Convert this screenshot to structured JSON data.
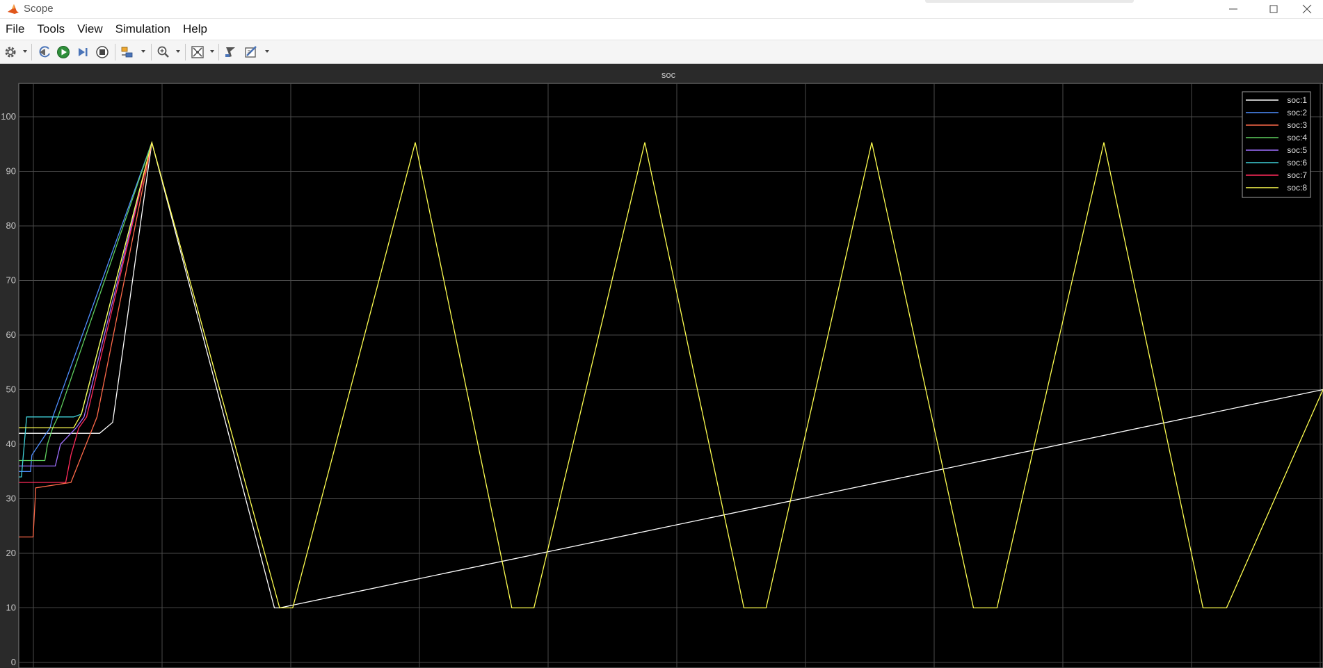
{
  "window": {
    "title": "Scope"
  },
  "menu": [
    "File",
    "Tools",
    "View",
    "Simulation",
    "Help"
  ],
  "toolbar": [
    "settings-icon",
    "step-back-icon",
    "run-icon",
    "step-forward-icon",
    "stop-icon",
    "signal-highlight-icon",
    "zoom-icon",
    "autoscale-icon",
    "cursor-icon",
    "measurements-icon"
  ],
  "colors": {
    "plot_background": "#000000",
    "frame_background": "#2a2a2a",
    "grid": "#4a4a4a",
    "axis_text": "#c8c8c8"
  },
  "chart_data": {
    "type": "line",
    "title": "soc",
    "xlabel": "",
    "ylabel": "",
    "ylim": [
      0,
      100
    ],
    "yticks": [
      0,
      10,
      20,
      30,
      40,
      50,
      60,
      70,
      80,
      90,
      100
    ],
    "grid": true,
    "legend_position": "top-right",
    "series": [
      {
        "name": "soc:1",
        "color": "#ffffff",
        "x": [
          0,
          0.062,
          0.072,
          0.102,
          0.196,
          0.2,
          1.0
        ],
        "y": [
          42,
          42,
          44,
          95.3,
          10,
          10,
          50
        ]
      },
      {
        "name": "soc:2",
        "color": "#4f8fff",
        "x": [
          0,
          0.009,
          0.01,
          0.024,
          0.026,
          0.102
        ],
        "y": [
          35,
          35,
          38,
          43,
          45,
          95.3
        ]
      },
      {
        "name": "soc:3",
        "color": "#ff6a4a",
        "x": [
          0,
          0.011,
          0.013,
          0.04,
          0.06,
          0.102
        ],
        "y": [
          23,
          23,
          32,
          33,
          45,
          95.3
        ]
      },
      {
        "name": "soc:4",
        "color": "#5fcf5f",
        "x": [
          0,
          0.02,
          0.022,
          0.026,
          0.03,
          0.102
        ],
        "y": [
          37,
          37,
          40,
          43,
          45,
          95.3
        ]
      },
      {
        "name": "soc:5",
        "color": "#a070ff",
        "x": [
          0,
          0.028,
          0.032,
          0.044,
          0.05,
          0.102
        ],
        "y": [
          36,
          36,
          40,
          43,
          45,
          95.3
        ]
      },
      {
        "name": "soc:6",
        "color": "#3fd0d8",
        "x": [
          0,
          0.002,
          0.006,
          0.042,
          0.048,
          0.102
        ],
        "y": [
          34,
          34,
          45,
          45,
          45.5,
          95.3
        ]
      },
      {
        "name": "soc:7",
        "color": "#ff2a5a",
        "x": [
          0,
          0.036,
          0.04,
          0.046,
          0.052,
          0.102
        ],
        "y": [
          33,
          33,
          38,
          43,
          45,
          95.3
        ]
      },
      {
        "name": "soc:8",
        "color": "#ffff50",
        "x": [
          0,
          0.042,
          0.048,
          0.102,
          0.2,
          0.21,
          0.304,
          0.378,
          0.395,
          0.48,
          0.556,
          0.573,
          0.654,
          0.732,
          0.75,
          0.832,
          0.908,
          0.926,
          1.0
        ],
        "y": [
          43,
          43,
          45.5,
          95.3,
          10,
          10,
          95.3,
          10,
          10,
          95.3,
          10,
          10,
          95.3,
          10,
          10,
          95.3,
          10,
          10,
          50
        ]
      }
    ]
  }
}
